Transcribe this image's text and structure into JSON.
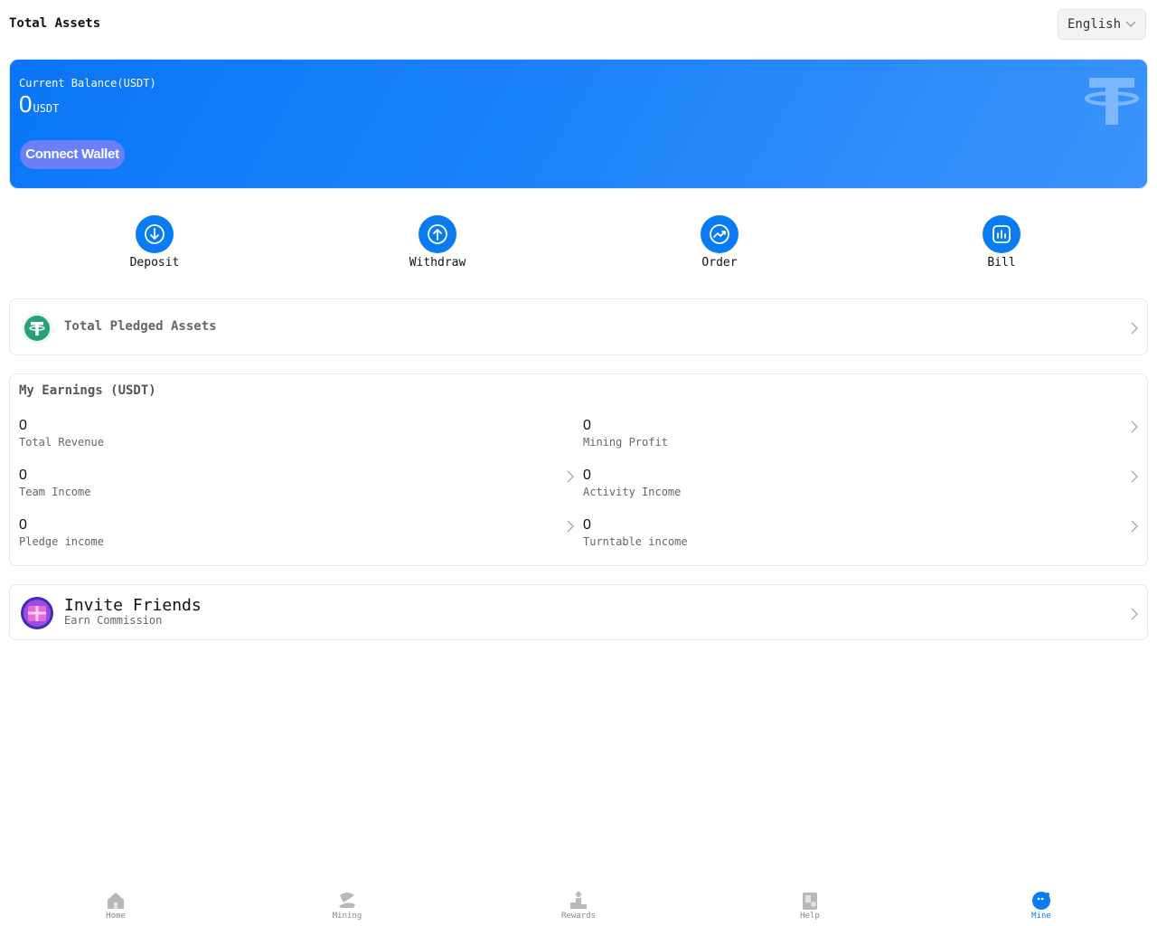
{
  "header": {
    "title": "Total Assets",
    "language": "English"
  },
  "balance": {
    "label": "Current Balance(USDT)",
    "value": "0",
    "unit": "USDT",
    "connect_label": "Connect Wallet"
  },
  "actions": [
    {
      "label": "Deposit",
      "icon": "deposit-icon"
    },
    {
      "label": "Withdraw",
      "icon": "withdraw-icon"
    },
    {
      "label": "Order",
      "icon": "order-icon"
    },
    {
      "label": "Bill",
      "icon": "bill-icon"
    }
  ],
  "pledged": {
    "label": "Total Pledged Assets"
  },
  "earnings": {
    "title": "My Earnings (USDT)",
    "items": [
      {
        "value": "0",
        "label": "Total Revenue"
      },
      {
        "value": "0",
        "label": "Mining Profit"
      },
      {
        "value": "0",
        "label": "Team Income"
      },
      {
        "value": "0",
        "label": "Activity Income"
      },
      {
        "value": "0",
        "label": "Pledge income"
      },
      {
        "value": "0",
        "label": "Turntable income"
      }
    ]
  },
  "invite": {
    "title": "Invite Friends",
    "subtitle": "Earn Commission"
  },
  "tabbar": [
    {
      "label": "Home",
      "icon": "home-icon"
    },
    {
      "label": "Mining",
      "icon": "mining-icon"
    },
    {
      "label": "Rewards",
      "icon": "rewards-icon"
    },
    {
      "label": "Help",
      "icon": "help-icon"
    },
    {
      "label": "Mine",
      "icon": "mine-icon",
      "active": true
    }
  ],
  "colors": {
    "primary": "#0a7cf3",
    "tether_green": "#26a17b",
    "connect_button": "#6a7ff8"
  }
}
